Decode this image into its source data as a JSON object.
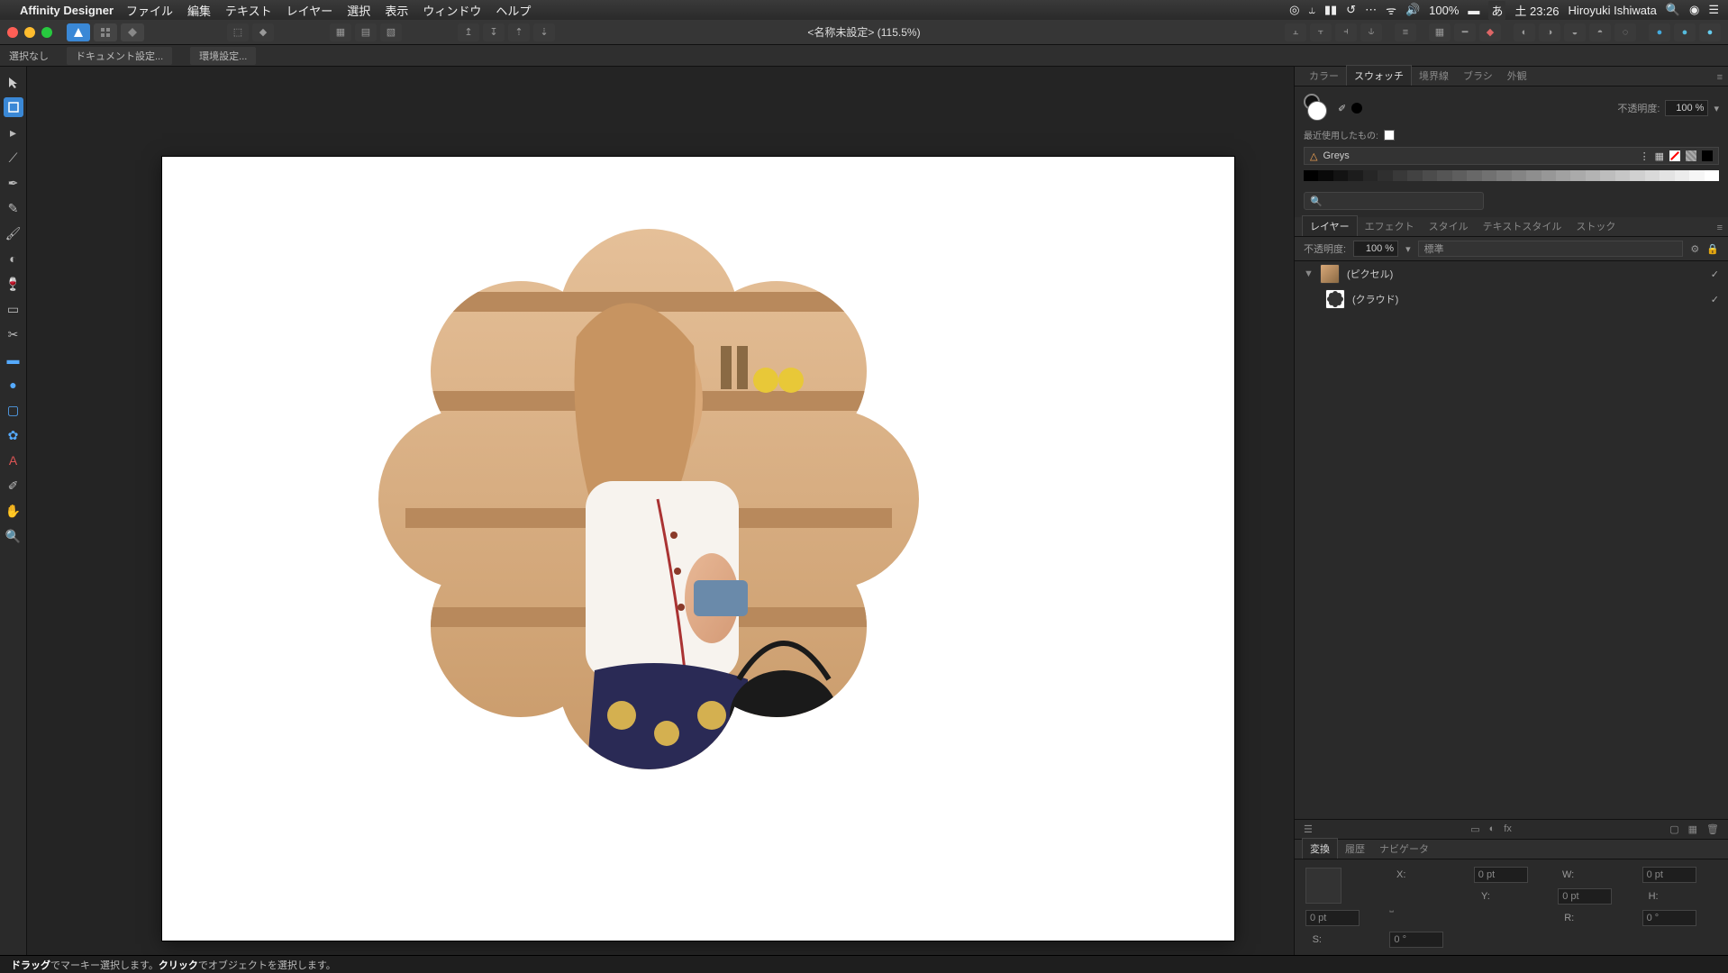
{
  "menubar": {
    "app_name": "Affinity Designer",
    "items": [
      "ファイル",
      "編集",
      "テキスト",
      "レイヤー",
      "選択",
      "表示",
      "ウィンドウ",
      "ヘルプ"
    ],
    "battery": "100%",
    "ime": "あ",
    "clock": "土 23:26",
    "user": "Hiroyuki Ishiwata"
  },
  "titlebar": {
    "doc_title": "<名称未設定> (115.5%)"
  },
  "contextbar": {
    "selection": "選択なし",
    "doc_settings": "ドキュメント設定...",
    "prefs": "環境設定..."
  },
  "panels": {
    "color_tabs": [
      "カラー",
      "スウォッチ",
      "境界線",
      "ブラシ",
      "外観"
    ],
    "color_active": 1,
    "opacity_label": "不透明度:",
    "opacity_value": "100 %",
    "recent_label": "最近使用したもの:",
    "palette_name": "Greys",
    "layer_tabs": [
      "レイヤー",
      "エフェクト",
      "スタイル",
      "テキストスタイル",
      "ストック"
    ],
    "layer_active": 0,
    "layer_opacity_label": "不透明度:",
    "layer_opacity_value": "100 %",
    "blend_mode": "標準",
    "layers": [
      {
        "name": "(ピクセル)",
        "expanded": true,
        "visible": true
      },
      {
        "name": "(クラウド)",
        "child": true,
        "visible": true
      }
    ],
    "transform_tabs": [
      "変換",
      "履歴",
      "ナビゲータ"
    ],
    "transform_active": 0,
    "transform": {
      "x_label": "X:",
      "x": "0 pt",
      "y_label": "Y:",
      "y": "0 pt",
      "w_label": "W:",
      "w": "0 pt",
      "h_label": "H:",
      "h": "0 pt",
      "r_label": "R:",
      "r": "0 °",
      "s_label": "S:",
      "s": "0 °"
    }
  },
  "statusbar": {
    "text_before_bold1": "",
    "bold1": "ドラッグ",
    "text_mid1": "でマーキー選択します。",
    "bold2": "クリック",
    "text_after": "でオブジェクトを選択します。"
  },
  "tools": [
    "move",
    "node",
    "pen",
    "pencil",
    "brush",
    "vector-brush",
    "fill",
    "gradient",
    "transparency",
    "crop",
    "shape-rect",
    "shape-ellipse",
    "shape-rounded",
    "shape-cog",
    "text",
    "color-picker",
    "hand",
    "zoom"
  ],
  "icons": {
    "apple": "",
    "search": "🔍",
    "siri": "◉",
    "list": "☰",
    "wifi": "⚲",
    "volume": "🔊",
    "battery_icon": "◙",
    "check": "✓",
    "triangle_right": "▶",
    "triangle_down": "▼"
  }
}
